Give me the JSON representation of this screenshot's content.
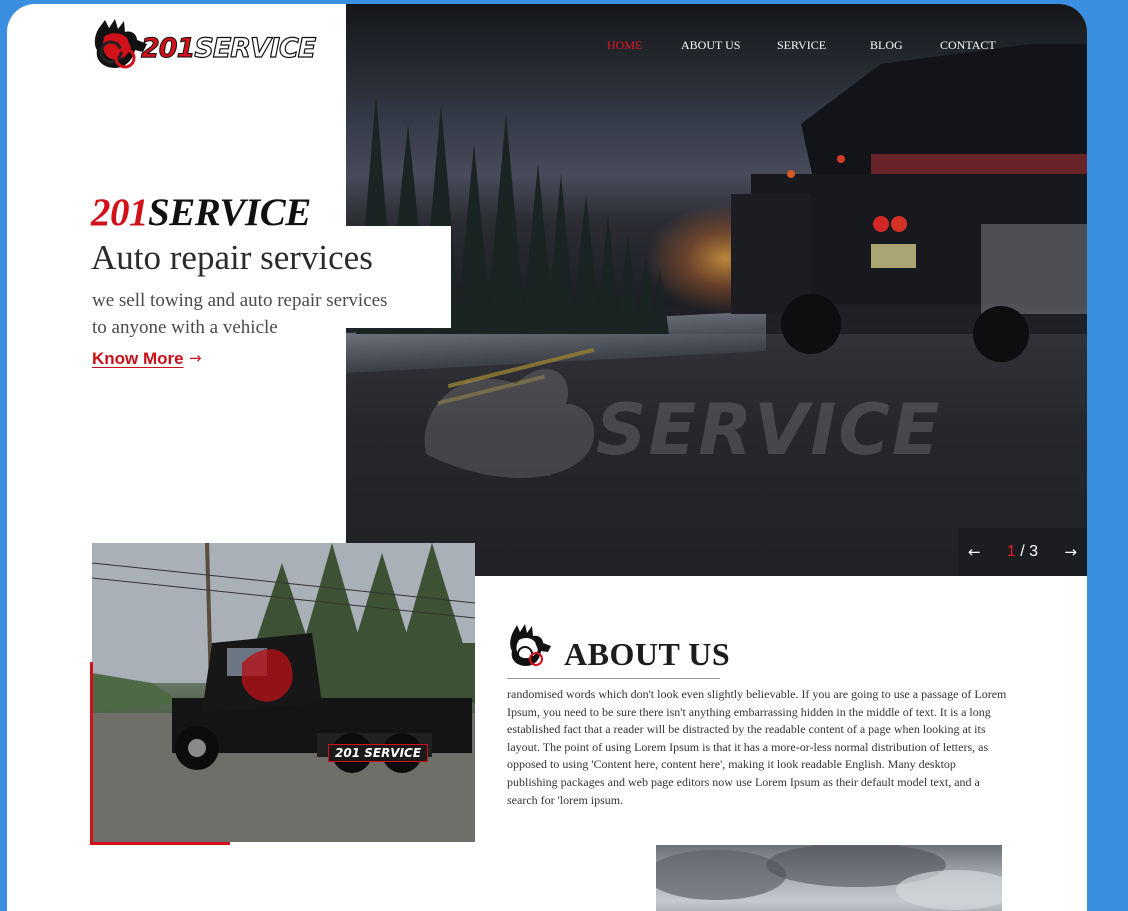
{
  "brand": {
    "logo_number": "201",
    "logo_word": "SERVICE"
  },
  "nav": {
    "items": [
      {
        "label": "HOME",
        "active": true
      },
      {
        "label": "ABOUT US",
        "active": false
      },
      {
        "label": "SERVICE",
        "active": false
      },
      {
        "label": "BLOG",
        "active": false
      },
      {
        "label": "CONTACT",
        "active": false
      }
    ]
  },
  "hero": {
    "title_number": "201",
    "title_word": "SERVICE",
    "subtitle": "Auto repair services",
    "description_line1": "we sell towing and auto repair services",
    "description_line2": "to anyone with a vehicle",
    "cta_label": "Know More",
    "cta_icon": "arrow-right-icon",
    "watermark_text": "SERVICE"
  },
  "slider": {
    "current": "1",
    "separator": "/",
    "total": "3",
    "prev_icon": "arrow-left-icon",
    "next_icon": "arrow-right-icon"
  },
  "about": {
    "title": "ABOUT US",
    "body": "randomised words which don't look even slightly believable. If you are going to use a passage of Lorem Ipsum, you need to be sure there isn't anything embarrassing hidden in the middle of text. It is a long established fact that a reader will be distracted by the readable content of a page when looking at its layout. The point of using Lorem Ipsum is that it has a more-or-less normal distribution of letters, as opposed to using 'Content here, content here', making it look readable English. Many desktop publishing packages and web page editors now use Lorem Ipsum as their default model text, and a search for 'lorem ipsum.",
    "photo_truck_label": "201 SERVICE"
  },
  "colors": {
    "accent": "#d1111a",
    "background": "#3b8fe0",
    "page": "#ffffff",
    "text_dark": "#1c1c1c"
  }
}
